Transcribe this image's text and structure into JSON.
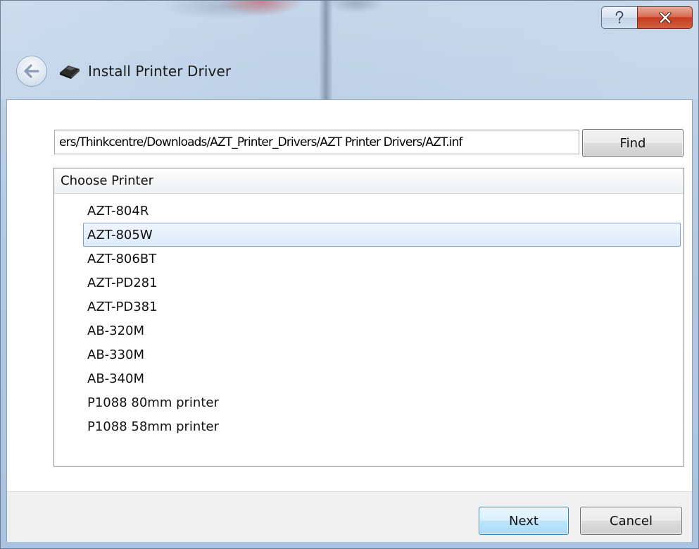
{
  "window": {
    "title": "Install Printer Driver",
    "controls": {
      "help_icon": "question-mark-icon",
      "close_icon": "close-x-icon"
    },
    "colors": {
      "frame": "#b3cae4",
      "close_button": "#c53a20",
      "selection_border": "#7da2ce",
      "selection_fill": "#dceafb"
    }
  },
  "header": {
    "back_icon": "back-arrow-icon",
    "app_icon": "printer-icon",
    "title": "Install Printer Driver"
  },
  "path": {
    "value": "C:/Users/Thinkcentre/Downloads/AZT_Printer_Drivers/AZT Printer Drivers/AZT.inf",
    "visible_value": "ers/Thinkcentre/Downloads/AZT_Printer_Drivers/AZT Printer Drivers/AZT.inf"
  },
  "find_button": {
    "label": "Find"
  },
  "printer_list": {
    "header": "Choose Printer",
    "items": [
      {
        "label": "AZT-804R",
        "selected": false
      },
      {
        "label": "AZT-805W",
        "selected": true
      },
      {
        "label": "AZT-806BT",
        "selected": false
      },
      {
        "label": "AZT-PD281",
        "selected": false
      },
      {
        "label": "AZT-PD381",
        "selected": false
      },
      {
        "label": "AB-320M",
        "selected": false
      },
      {
        "label": "AB-330M",
        "selected": false
      },
      {
        "label": "AB-340M",
        "selected": false
      },
      {
        "label": "P1088 80mm printer",
        "selected": false
      },
      {
        "label": "P1088 58mm printer",
        "selected": false
      }
    ]
  },
  "footer": {
    "next_label": "Next",
    "cancel_label": "Cancel"
  }
}
